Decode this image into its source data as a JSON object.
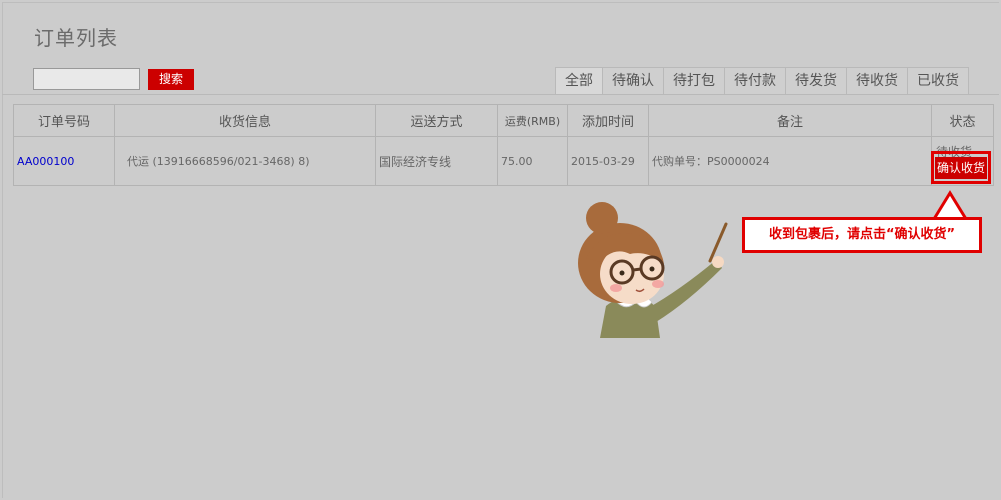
{
  "header": {
    "title": "订单列表"
  },
  "search": {
    "value": "",
    "placeholder": "",
    "button_label": "搜索"
  },
  "tabs": [
    {
      "label": "全部",
      "active": true
    },
    {
      "label": "待确认",
      "active": false
    },
    {
      "label": "待打包",
      "active": false
    },
    {
      "label": "待付款",
      "active": false
    },
    {
      "label": "待发货",
      "active": false
    },
    {
      "label": "待收货",
      "active": false
    },
    {
      "label": "已收货",
      "active": false
    }
  ],
  "table": {
    "columns": [
      "订单号码",
      "收货信息",
      "运送方式",
      "运费(RMB)",
      "添加时间",
      "备注",
      "状态"
    ],
    "rows": [
      {
        "order_no": "AA000100",
        "shipping_info": "代运 (13916668596/021-3468) 8)",
        "shipping_method": "国际经济专线",
        "fee": "75.00",
        "added_time": "2015-03-29",
        "remark": "代购单号：PS0000024",
        "status": "待收货",
        "action_label": "确认收货"
      }
    ]
  },
  "callout": {
    "text": "收到包裹后，请点击“确认收货”"
  },
  "colors": {
    "accent": "#cc0000",
    "highlight": "#e00000",
    "background": "#cccccc",
    "link": "#0000cc"
  }
}
